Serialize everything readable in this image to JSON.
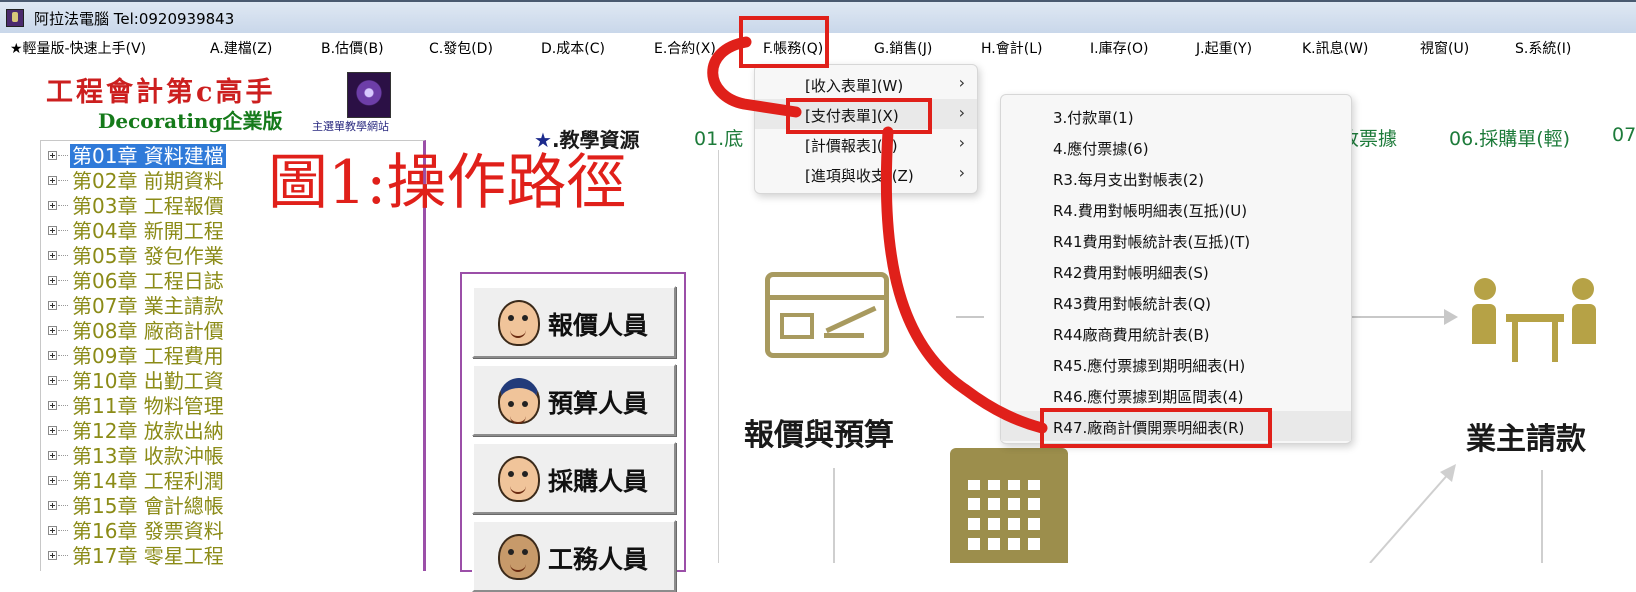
{
  "window": {
    "title": "阿拉法電腦 Tel:0920939843",
    "icon": "app-icon"
  },
  "menubar": {
    "items": [
      "★輕量版-快速上手(V)",
      "A.建檔(Z)",
      "B.估價(B)",
      "C.發包(D)",
      "D.成本(C)",
      "E.合約(X)",
      "F.帳務(Q)",
      "G.銷售(J)",
      "H.會計(L)",
      "I.庫存(O)",
      "J.起重(Y)",
      "K.訊息(W)",
      "視窗(U)",
      "S.系統(I)"
    ],
    "highlighted_index": 6
  },
  "brand": {
    "title": "工程會計第c高手",
    "subtitle": "Decorating企業版",
    "logo_caption": "主選單教學網站"
  },
  "tree": {
    "selected_index": 0,
    "items": [
      "第01章 資料建檔",
      "第02章 前期資料",
      "第03章 工程報價",
      "第04章 新開工程",
      "第05章 發包作業",
      "第06章 工程日誌",
      "第07章 業主請款",
      "第08章 廠商計價",
      "第09章 工程費用",
      "第10章 出勤工資",
      "第11章 物料管理",
      "第12章 放款出納",
      "第13章 收款沖帳",
      "第14章 工程利潤",
      "第15章 會計總帳",
      "第16章 發票資料",
      "第17章 零星工程"
    ]
  },
  "annotation": {
    "path_note": "圖1:操作路徑",
    "color": "#e0201a"
  },
  "teaching": {
    "title_star": "★",
    "title": ".教學資源",
    "links": [
      "01.底",
      "收票據",
      "06.採購單(輕)",
      "07"
    ]
  },
  "roles": [
    {
      "label": "報價人員",
      "icon": "pc-user-icon"
    },
    {
      "label": "預算人員",
      "icon": "hat-person-icon"
    },
    {
      "label": "採購人員",
      "icon": "smiling-face-icon"
    },
    {
      "label": "工務人員",
      "icon": "worker-face-icon"
    }
  ],
  "diagram": {
    "left_label": "報價與預算",
    "right_label": "業主請款",
    "icon_color": "#a89a5f"
  },
  "finance_menu": {
    "items": [
      {
        "label": "[收入表單](W)",
        "has_submenu": true
      },
      {
        "label": "[支付表單](X)",
        "has_submenu": true,
        "highlighted": true
      },
      {
        "label": "[計價報表](Y)",
        "has_submenu": true
      },
      {
        "label": "[進項與收支](Z)",
        "has_submenu": true
      }
    ]
  },
  "payment_submenu": {
    "items": [
      {
        "label": "3.付款單(1)"
      },
      {
        "label": "4.應付票據(6)"
      },
      {
        "label": "R3.每月支出對帳表(2)"
      },
      {
        "label": "R4.費用對帳明細表(互抵)(U)"
      },
      {
        "label": "R41費用對帳統計表(互抵)(T)"
      },
      {
        "label": "R42費用對帳明細表(S)"
      },
      {
        "label": "R43費用對帳統計表(Q)"
      },
      {
        "label": "R44廠商費用統計表(B)"
      },
      {
        "label": "R45.應付票據到期明細表(H)"
      },
      {
        "label": "R46.應付票據到期區間表(4)"
      },
      {
        "label": "R47.廠商計價開票明細表(R)",
        "highlighted": true
      }
    ]
  }
}
